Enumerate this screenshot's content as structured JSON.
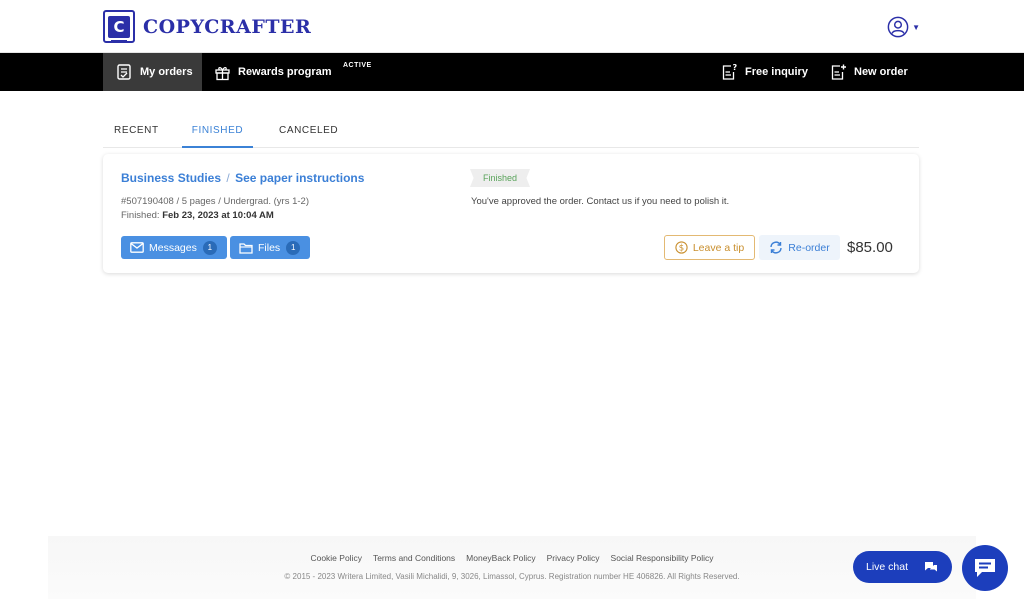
{
  "brand": {
    "logo_letter": "C",
    "name": "COPYCRAFTER"
  },
  "nav": {
    "my_orders": "My orders",
    "rewards": "Rewards program",
    "rewards_tag": "ACTIVE",
    "free_inquiry": "Free inquiry",
    "new_order": "New order"
  },
  "tabs": [
    {
      "label": "RECENT",
      "active": false
    },
    {
      "label": "FINISHED",
      "active": true
    },
    {
      "label": "CANCELED",
      "active": false
    }
  ],
  "order": {
    "subject": "Business Studies",
    "separator": "/",
    "instructions_link": "See paper instructions",
    "meta": "#507190408 / 5 pages / Undergrad. (yrs 1-2)",
    "finished_label": "Finished:",
    "finished_date": "Feb 23, 2023 at 10:04 AM",
    "status": "Finished",
    "status_message": "You've approved the order. Contact us if you need to polish it.",
    "messages_label": "Messages",
    "messages_count": "1",
    "files_label": "Files",
    "files_count": "1",
    "tip_label": "Leave a tip",
    "reorder_label": "Re-order",
    "price": "$85.00"
  },
  "footer": {
    "links": [
      "Cookie Policy",
      "Terms and Conditions",
      "MoneyBack Policy",
      "Privacy Policy",
      "Social Responsibility Policy"
    ],
    "copyright": "© 2015 - 2023 Writera Limited, Vasili Michalidi, 9, 3026, Limassol, Cyprus. Registration number HE 406826. All Rights Reserved."
  },
  "chat": {
    "label": "Live chat"
  },
  "colors": {
    "brand": "#2b2fa8",
    "accent": "#4a90e2",
    "link": "#3b7fd6",
    "status_green": "#59a35a",
    "tip": "#c98f2e",
    "chat": "#1c3ebc"
  },
  "icons": [
    "logo-icon",
    "user-icon",
    "orders-icon",
    "gift-icon",
    "inquiry-icon",
    "new-order-icon",
    "envelope-icon",
    "folder-icon",
    "dollar-icon",
    "refresh-icon",
    "chat-bubbles-icon",
    "message-icon"
  ]
}
